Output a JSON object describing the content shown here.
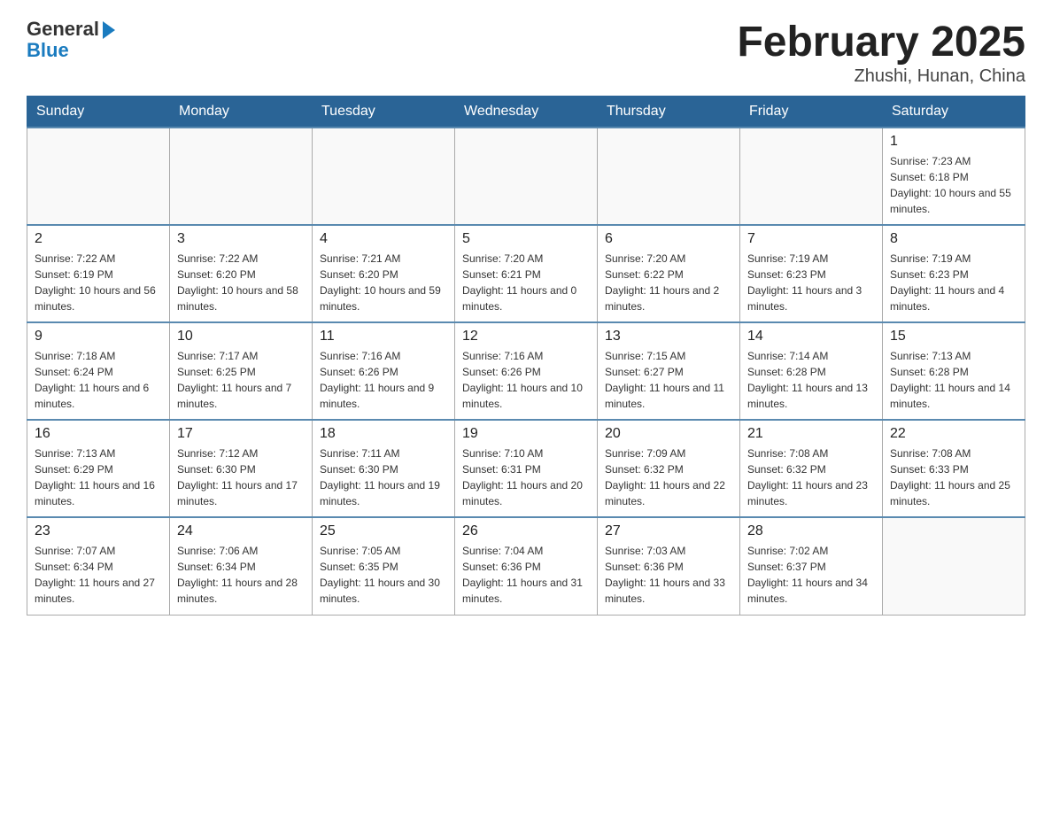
{
  "header": {
    "logo_general": "General",
    "logo_blue": "Blue",
    "title": "February 2025",
    "subtitle": "Zhushi, Hunan, China"
  },
  "days_of_week": [
    "Sunday",
    "Monday",
    "Tuesday",
    "Wednesday",
    "Thursday",
    "Friday",
    "Saturday"
  ],
  "weeks": [
    [
      {
        "day": "",
        "sunrise": "",
        "sunset": "",
        "daylight": ""
      },
      {
        "day": "",
        "sunrise": "",
        "sunset": "",
        "daylight": ""
      },
      {
        "day": "",
        "sunrise": "",
        "sunset": "",
        "daylight": ""
      },
      {
        "day": "",
        "sunrise": "",
        "sunset": "",
        "daylight": ""
      },
      {
        "day": "",
        "sunrise": "",
        "sunset": "",
        "daylight": ""
      },
      {
        "day": "",
        "sunrise": "",
        "sunset": "",
        "daylight": ""
      },
      {
        "day": "1",
        "sunrise": "Sunrise: 7:23 AM",
        "sunset": "Sunset: 6:18 PM",
        "daylight": "Daylight: 10 hours and 55 minutes."
      }
    ],
    [
      {
        "day": "2",
        "sunrise": "Sunrise: 7:22 AM",
        "sunset": "Sunset: 6:19 PM",
        "daylight": "Daylight: 10 hours and 56 minutes."
      },
      {
        "day": "3",
        "sunrise": "Sunrise: 7:22 AM",
        "sunset": "Sunset: 6:20 PM",
        "daylight": "Daylight: 10 hours and 58 minutes."
      },
      {
        "day": "4",
        "sunrise": "Sunrise: 7:21 AM",
        "sunset": "Sunset: 6:20 PM",
        "daylight": "Daylight: 10 hours and 59 minutes."
      },
      {
        "day": "5",
        "sunrise": "Sunrise: 7:20 AM",
        "sunset": "Sunset: 6:21 PM",
        "daylight": "Daylight: 11 hours and 0 minutes."
      },
      {
        "day": "6",
        "sunrise": "Sunrise: 7:20 AM",
        "sunset": "Sunset: 6:22 PM",
        "daylight": "Daylight: 11 hours and 2 minutes."
      },
      {
        "day": "7",
        "sunrise": "Sunrise: 7:19 AM",
        "sunset": "Sunset: 6:23 PM",
        "daylight": "Daylight: 11 hours and 3 minutes."
      },
      {
        "day": "8",
        "sunrise": "Sunrise: 7:19 AM",
        "sunset": "Sunset: 6:23 PM",
        "daylight": "Daylight: 11 hours and 4 minutes."
      }
    ],
    [
      {
        "day": "9",
        "sunrise": "Sunrise: 7:18 AM",
        "sunset": "Sunset: 6:24 PM",
        "daylight": "Daylight: 11 hours and 6 minutes."
      },
      {
        "day": "10",
        "sunrise": "Sunrise: 7:17 AM",
        "sunset": "Sunset: 6:25 PM",
        "daylight": "Daylight: 11 hours and 7 minutes."
      },
      {
        "day": "11",
        "sunrise": "Sunrise: 7:16 AM",
        "sunset": "Sunset: 6:26 PM",
        "daylight": "Daylight: 11 hours and 9 minutes."
      },
      {
        "day": "12",
        "sunrise": "Sunrise: 7:16 AM",
        "sunset": "Sunset: 6:26 PM",
        "daylight": "Daylight: 11 hours and 10 minutes."
      },
      {
        "day": "13",
        "sunrise": "Sunrise: 7:15 AM",
        "sunset": "Sunset: 6:27 PM",
        "daylight": "Daylight: 11 hours and 11 minutes."
      },
      {
        "day": "14",
        "sunrise": "Sunrise: 7:14 AM",
        "sunset": "Sunset: 6:28 PM",
        "daylight": "Daylight: 11 hours and 13 minutes."
      },
      {
        "day": "15",
        "sunrise": "Sunrise: 7:13 AM",
        "sunset": "Sunset: 6:28 PM",
        "daylight": "Daylight: 11 hours and 14 minutes."
      }
    ],
    [
      {
        "day": "16",
        "sunrise": "Sunrise: 7:13 AM",
        "sunset": "Sunset: 6:29 PM",
        "daylight": "Daylight: 11 hours and 16 minutes."
      },
      {
        "day": "17",
        "sunrise": "Sunrise: 7:12 AM",
        "sunset": "Sunset: 6:30 PM",
        "daylight": "Daylight: 11 hours and 17 minutes."
      },
      {
        "day": "18",
        "sunrise": "Sunrise: 7:11 AM",
        "sunset": "Sunset: 6:30 PM",
        "daylight": "Daylight: 11 hours and 19 minutes."
      },
      {
        "day": "19",
        "sunrise": "Sunrise: 7:10 AM",
        "sunset": "Sunset: 6:31 PM",
        "daylight": "Daylight: 11 hours and 20 minutes."
      },
      {
        "day": "20",
        "sunrise": "Sunrise: 7:09 AM",
        "sunset": "Sunset: 6:32 PM",
        "daylight": "Daylight: 11 hours and 22 minutes."
      },
      {
        "day": "21",
        "sunrise": "Sunrise: 7:08 AM",
        "sunset": "Sunset: 6:32 PM",
        "daylight": "Daylight: 11 hours and 23 minutes."
      },
      {
        "day": "22",
        "sunrise": "Sunrise: 7:08 AM",
        "sunset": "Sunset: 6:33 PM",
        "daylight": "Daylight: 11 hours and 25 minutes."
      }
    ],
    [
      {
        "day": "23",
        "sunrise": "Sunrise: 7:07 AM",
        "sunset": "Sunset: 6:34 PM",
        "daylight": "Daylight: 11 hours and 27 minutes."
      },
      {
        "day": "24",
        "sunrise": "Sunrise: 7:06 AM",
        "sunset": "Sunset: 6:34 PM",
        "daylight": "Daylight: 11 hours and 28 minutes."
      },
      {
        "day": "25",
        "sunrise": "Sunrise: 7:05 AM",
        "sunset": "Sunset: 6:35 PM",
        "daylight": "Daylight: 11 hours and 30 minutes."
      },
      {
        "day": "26",
        "sunrise": "Sunrise: 7:04 AM",
        "sunset": "Sunset: 6:36 PM",
        "daylight": "Daylight: 11 hours and 31 minutes."
      },
      {
        "day": "27",
        "sunrise": "Sunrise: 7:03 AM",
        "sunset": "Sunset: 6:36 PM",
        "daylight": "Daylight: 11 hours and 33 minutes."
      },
      {
        "day": "28",
        "sunrise": "Sunrise: 7:02 AM",
        "sunset": "Sunset: 6:37 PM",
        "daylight": "Daylight: 11 hours and 34 minutes."
      },
      {
        "day": "",
        "sunrise": "",
        "sunset": "",
        "daylight": ""
      }
    ]
  ]
}
